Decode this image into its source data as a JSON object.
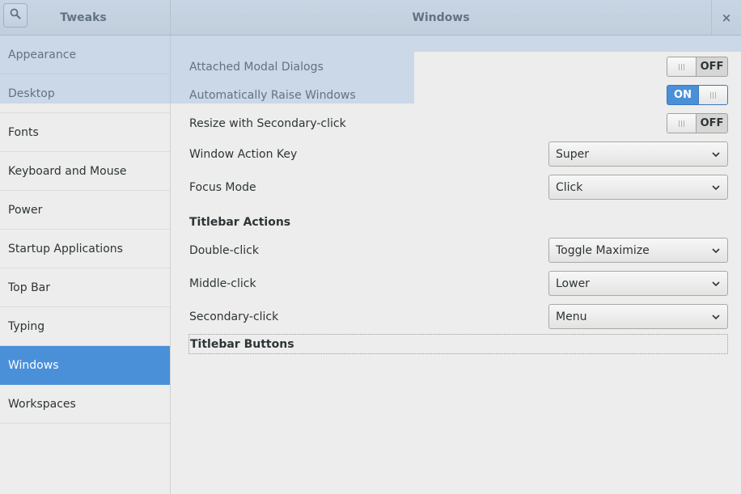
{
  "header": {
    "left_title": "Tweaks",
    "main_title": "Windows",
    "close_glyph": "×",
    "search_icon": "search-icon"
  },
  "sidebar": {
    "items": [
      {
        "label": "Appearance"
      },
      {
        "label": "Desktop"
      },
      {
        "label": "Fonts"
      },
      {
        "label": "Keyboard and Mouse"
      },
      {
        "label": "Power"
      },
      {
        "label": "Startup Applications"
      },
      {
        "label": "Top Bar"
      },
      {
        "label": "Typing"
      },
      {
        "label": "Windows",
        "active": true
      },
      {
        "label": "Workspaces"
      }
    ]
  },
  "settings": {
    "attached_modal_dialogs": {
      "label": "Attached Modal Dialogs",
      "state": "OFF"
    },
    "auto_raise_windows": {
      "label": "Automatically Raise Windows",
      "state": "ON"
    },
    "resize_secondary_click": {
      "label": "Resize with Secondary-click",
      "state": "OFF"
    },
    "window_action_key": {
      "label": "Window Action Key",
      "value": "Super"
    },
    "focus_mode": {
      "label": "Focus Mode",
      "value": "Click"
    }
  },
  "titlebar_actions": {
    "title": "Titlebar Actions",
    "double_click": {
      "label": "Double-click",
      "value": "Toggle Maximize"
    },
    "middle_click": {
      "label": "Middle-click",
      "value": "Lower"
    },
    "secondary_click": {
      "label": "Secondary-click",
      "value": "Menu"
    }
  },
  "titlebar_buttons": {
    "title": "Titlebar Buttons"
  },
  "colors": {
    "accent": "#4a90d9",
    "background": "#ededed",
    "text": "#2e3436",
    "selection_tint": "#a0bee1"
  }
}
